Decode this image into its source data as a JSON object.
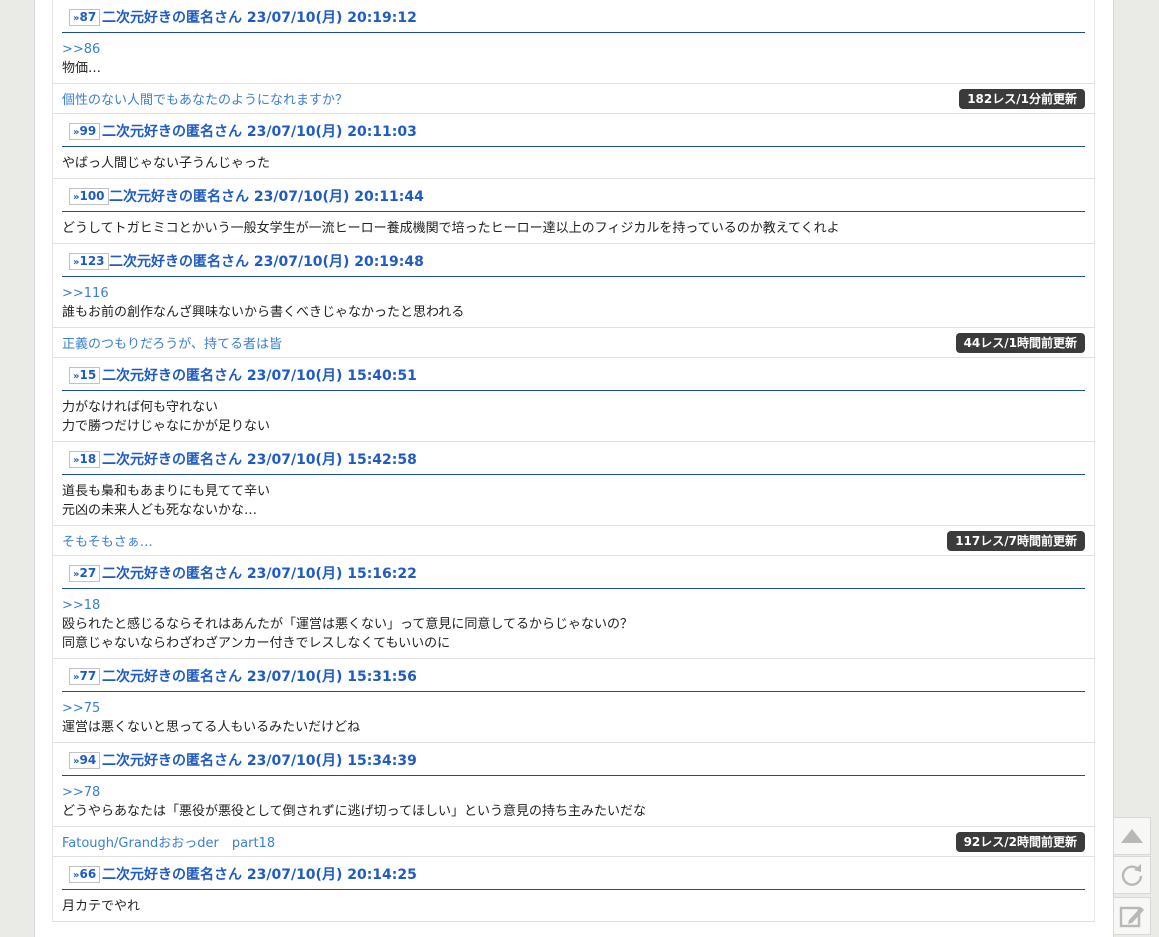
{
  "colors": {
    "accent": "#1f5bc4",
    "link": "#3a7fd4",
    "badge": "#3b3b3b",
    "rule": "#1f49a8"
  },
  "icons": {
    "top": "up-arrow-icon",
    "reload": "reload-icon",
    "write": "edit-icon"
  },
  "items": [
    {
      "type": "post",
      "num": "87",
      "name": "二次元好きの匿名さん  23/07/10(月) 20:19:12",
      "anchor": ">>86",
      "lines": [
        "物価…"
      ]
    },
    {
      "type": "thread",
      "title": "個性のない人間でもあなたのようになれますか？",
      "badge": "182レス/1分前更新"
    },
    {
      "type": "post",
      "num": "99",
      "name": "二次元好きの匿名さん  23/07/10(月) 20:11:03",
      "anchor": "",
      "lines": [
        "やばっ人間じゃない子うんじゃった"
      ]
    },
    {
      "type": "post",
      "num": "100",
      "name": "二次元好きの匿名さん  23/07/10(月) 20:11:44",
      "anchor": "",
      "lines": [
        "どうしてトガヒミコとかいう一般女学生が一流ヒーロー養成機関で培ったヒーロー達以上のフィジカルを持っているのか教えてくれよ"
      ]
    },
    {
      "type": "post",
      "num": "123",
      "name": "二次元好きの匿名さん  23/07/10(月) 20:19:48",
      "anchor": ">>116",
      "lines": [
        "誰もお前の創作なんざ興味ないから書くべきじゃなかったと思われる"
      ]
    },
    {
      "type": "thread",
      "title": "正義のつもりだろうが、持てる者は皆",
      "badge": "44レス/1時間前更新"
    },
    {
      "type": "post",
      "num": "15",
      "name": "二次元好きの匿名さん  23/07/10(月) 15:40:51",
      "anchor": "",
      "lines": [
        "力がなければ何も守れない",
        "力で勝つだけじゃなにかが足りない"
      ]
    },
    {
      "type": "post",
      "num": "18",
      "name": "二次元好きの匿名さん  23/07/10(月) 15:42:58",
      "anchor": "",
      "lines": [
        "道長も梟和もあまりにも見てて辛い",
        "元凶の未来人ども死なないかな…"
      ]
    },
    {
      "type": "thread",
      "title": "そもそもさぁ…",
      "badge": "117レス/7時間前更新"
    },
    {
      "type": "post",
      "num": "27",
      "name": "二次元好きの匿名さん  23/07/10(月) 15:16:22",
      "anchor": ">>18",
      "lines": [
        "殴られたと感じるならそれはあんたが「運営は悪くない」って意見に同意してるからじゃないの？",
        "同意じゃないならわざわざアンカー付きでレスしなくてもいいのに"
      ]
    },
    {
      "type": "post",
      "num": "77",
      "name": "二次元好きの匿名さん  23/07/10(月) 15:31:56",
      "anchor": ">>75",
      "lines": [
        "運営は悪くないと思ってる人もいるみたいだけどね"
      ]
    },
    {
      "type": "post",
      "num": "94",
      "name": "二次元好きの匿名さん  23/07/10(月) 15:34:39",
      "anchor": ">>78",
      "lines": [
        "どうやらあなたは「悪役が悪役として倒されずに逃げ切ってほしい」という意見の持ち主みたいだな"
      ]
    },
    {
      "type": "thread",
      "title": "Fatough/Grandおおっder　part18",
      "badge": "92レス/2時間前更新"
    },
    {
      "type": "post",
      "num": "66",
      "name": "二次元好きの匿名さん  23/07/10(月) 20:14:25",
      "anchor": "",
      "lines": [
        "月カテでやれ"
      ]
    }
  ]
}
